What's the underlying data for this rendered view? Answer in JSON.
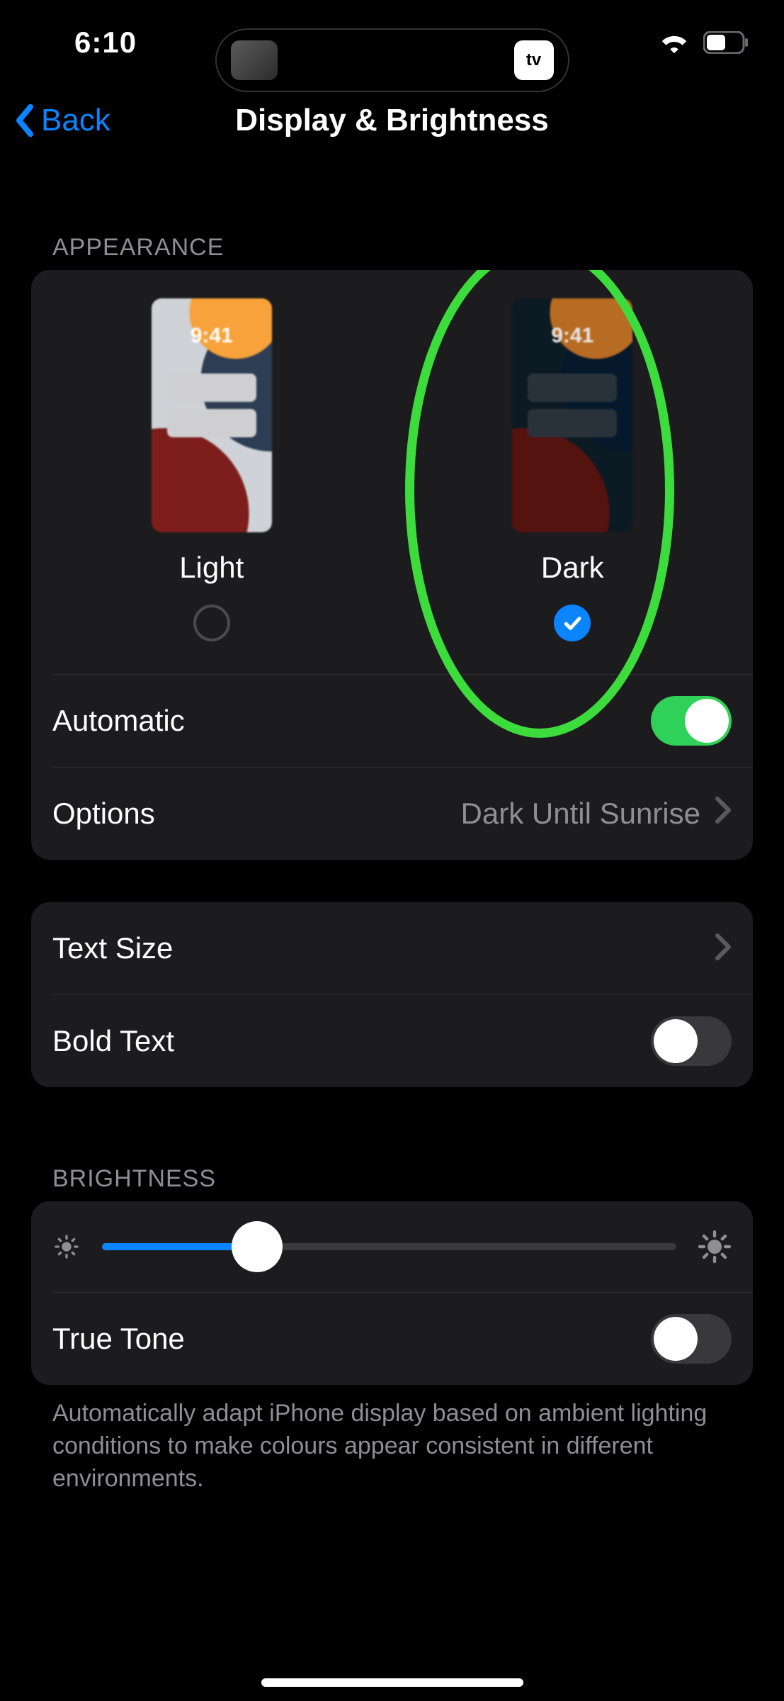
{
  "status": {
    "time": "6:10",
    "island_badge": "tv"
  },
  "nav": {
    "back": "Back",
    "title": "Display & Brightness"
  },
  "appearance": {
    "header": "APPEARANCE",
    "options": [
      {
        "label": "Light",
        "preview_time": "9:41",
        "selected": false
      },
      {
        "label": "Dark",
        "preview_time": "9:41",
        "selected": true
      }
    ],
    "automatic": {
      "label": "Automatic",
      "on": true
    },
    "options_row": {
      "label": "Options",
      "value": "Dark Until Sunrise"
    }
  },
  "text": {
    "textsize": {
      "label": "Text Size"
    },
    "bold": {
      "label": "Bold Text",
      "on": false
    }
  },
  "brightness": {
    "header": "BRIGHTNESS",
    "percent": 27,
    "truetone": {
      "label": "True Tone",
      "on": false
    },
    "footer": "Automatically adapt iPhone display based on ambient lighting conditions to make colours appear consistent in different environments."
  }
}
